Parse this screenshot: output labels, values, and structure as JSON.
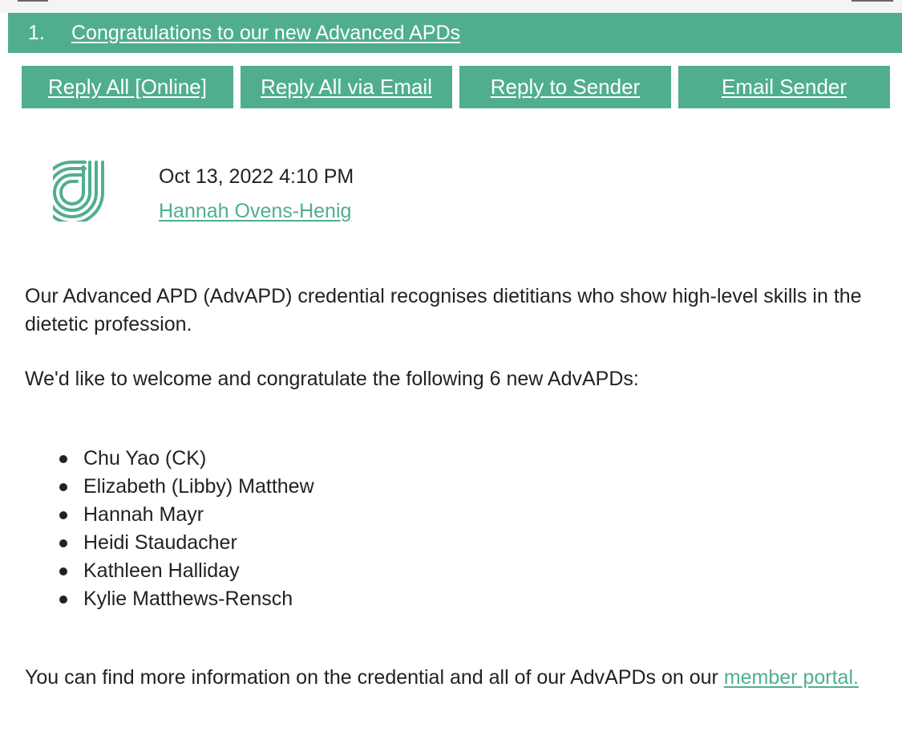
{
  "post": {
    "number": "1.",
    "title": "Congratulations to our new Advanced APDs"
  },
  "actions": {
    "reply_all_online": "Reply All [Online]",
    "reply_all_email": "Reply All via Email",
    "reply_sender": "Reply to Sender",
    "email_sender": "Email Sender"
  },
  "meta": {
    "date": "Oct 13, 2022 4:10 PM",
    "author": "Hannah Ovens-Henig",
    "avatar_icon": "organisation-logo-icon"
  },
  "body": {
    "intro": "Our Advanced APD (AdvAPD) credential recognises dietitians who show high-level skills in the dietetic profession.",
    "welcome": "We'd like to welcome and congratulate the following 6 new AdvAPDs:",
    "members": [
      "Chu Yao (CK)",
      "Elizabeth (Libby) Matthew",
      "Hannah Mayr",
      "Heidi Staudacher",
      "Kathleen Halliday",
      "Kylie Matthews-Rensch"
    ],
    "outro_text": "You can find more information on the credential and all of our AdvAPDs on our ",
    "outro_link": "member portal. "
  },
  "colors": {
    "accent": "#50ae8e",
    "text": "#222222",
    "background": "#ffffff"
  }
}
